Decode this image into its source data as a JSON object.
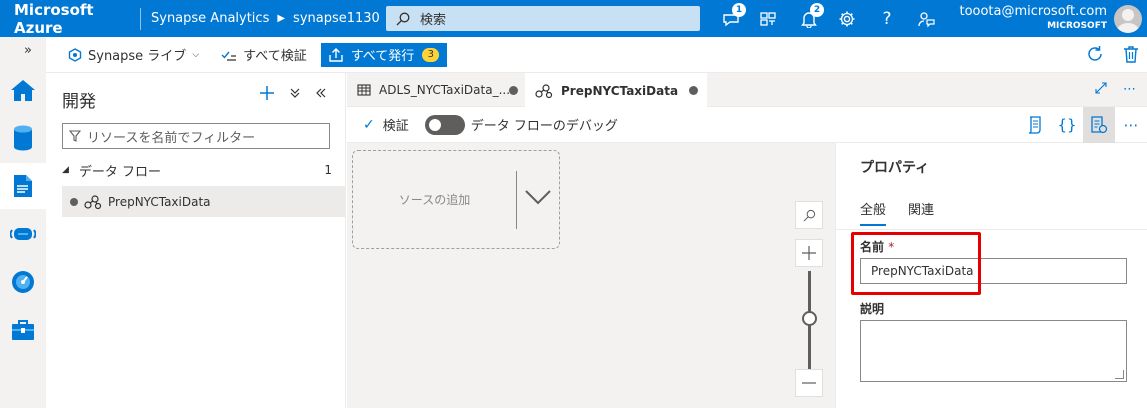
{
  "topbar": {
    "brand": "Microsoft Azure",
    "service": "Synapse Analytics",
    "workspace": "synapse1130",
    "search_placeholder": "検索",
    "notifications_a": "1",
    "notifications_b": "2",
    "user_email": "tooota@microsoft.com",
    "user_tenant": "MICROSOFT"
  },
  "rail": {
    "toggle": "»"
  },
  "cmdbar": {
    "synapse_live": "Synapse ライブ",
    "validate_all": "すべて検証",
    "publish_all": "すべて発行",
    "publish_count": "3"
  },
  "panel": {
    "title": "開発",
    "filter_placeholder": "リソースを名前でフィルター",
    "section_label": "データ フロー",
    "section_count": "1",
    "item": "PrepNYCTaxiData"
  },
  "tabs": [
    {
      "label": "ADLS_NYCTaxiData_..."
    },
    {
      "label": "PrepNYCTaxiData"
    }
  ],
  "editor": {
    "validate": "検証",
    "debug": "データ フローのデバッグ",
    "add_source": "ソースの追加"
  },
  "properties": {
    "title": "プロパティ",
    "tab_general": "全般",
    "tab_related": "関連",
    "name_label": "名前",
    "required_mark": "*",
    "name_value": "PrepNYCTaxiData",
    "description_label": "説明",
    "description_value": ""
  },
  "colors": {
    "azure_blue": "#0078d4",
    "highlight_red": "#e60000",
    "publish_badge": "#ffd335"
  }
}
